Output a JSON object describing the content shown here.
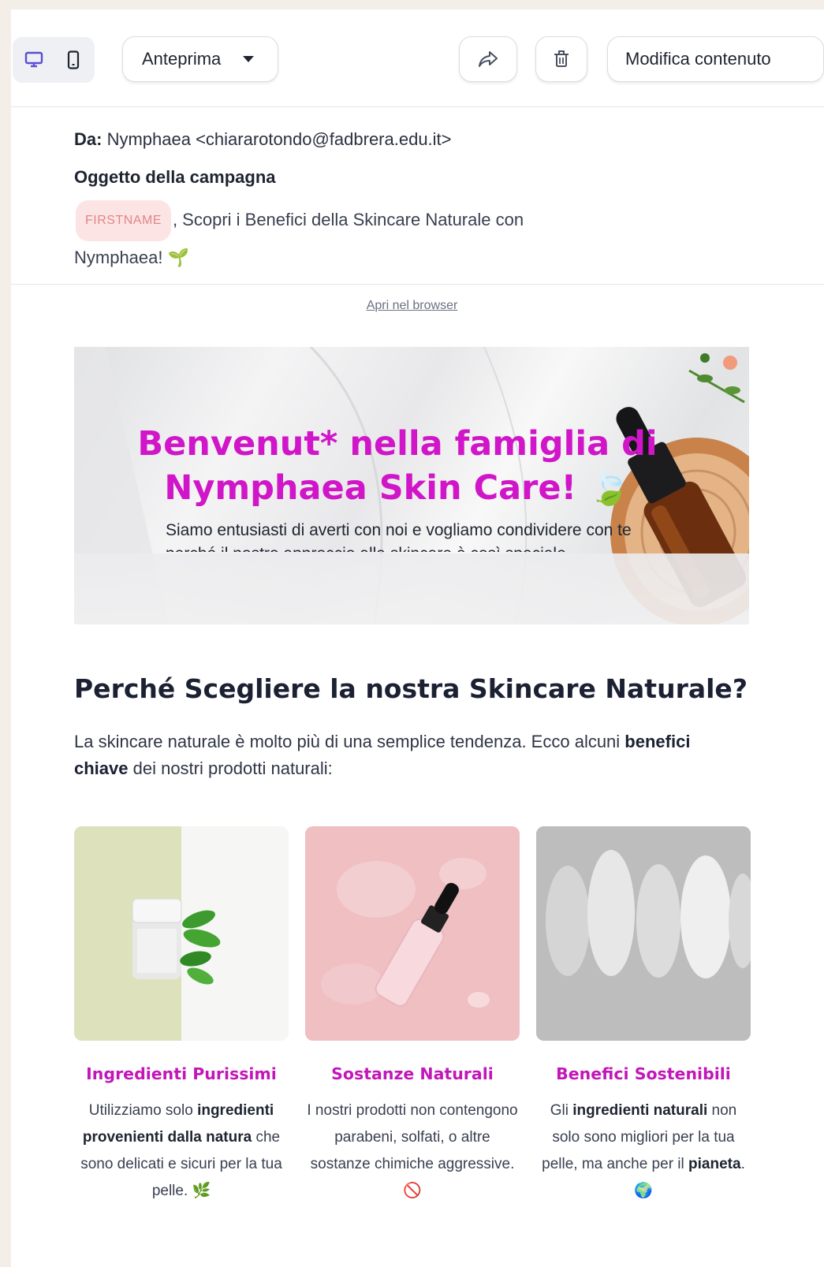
{
  "toolbar": {
    "preview_label": "Anteprima",
    "edit_label": "Modifica contenuto"
  },
  "email": {
    "from_label": "Da:",
    "from_value": "Nymphaea <chiararotondo@fadbrera.edu.it>",
    "subject_label": "Oggetto della campagna",
    "subject_chip": "FIRSTNAME",
    "subject_text_1": ", Scopri i Benefici della Skincare Naturale con",
    "subject_text_2": "Nymphaea! 🌱",
    "open_in_browser": "Apri nel browser"
  },
  "hero": {
    "title_line1": "Benvenut* nella famiglia di",
    "title_line2": "Nymphaea Skin Care! 🍃",
    "subtitle": "Siamo entusiasti di averti con noi e vogliamo condividere con te perché il nostro approccio alla skincare è così speciale."
  },
  "section": {
    "title": "Perché Scegliere la nostra Skincare Naturale?",
    "text_a": "La skincare naturale è molto più di una semplice tendenza. Ecco alcuni ",
    "text_bold": "benefici chiave",
    "text_b": " dei nostri prodotti naturali:"
  },
  "cards": [
    {
      "title": "Ingredienti Purissimi",
      "t1": "Utilizziamo solo ",
      "b1": "ingredienti provenienti dalla natura",
      "t2": " che sono delicati e sicuri per la tua pelle. 🌿"
    },
    {
      "title": "Sostanze Naturali",
      "t1": "I nostri prodotti non contengono parabeni, solfati, o altre sostanze chimiche aggressive. 🚫"
    },
    {
      "title": "Benefici Sostenibili",
      "t1": "Gli ",
      "b1": "ingredienti naturali",
      "t2": " non solo sono migliori per la tua pelle, ma anche per il ",
      "b2": "pianeta",
      "t3": ". 🌍"
    }
  ],
  "colors": {
    "accent_magenta": "#d016c8",
    "card_title": "#c316b9",
    "device_active": "#5a4fd6"
  }
}
